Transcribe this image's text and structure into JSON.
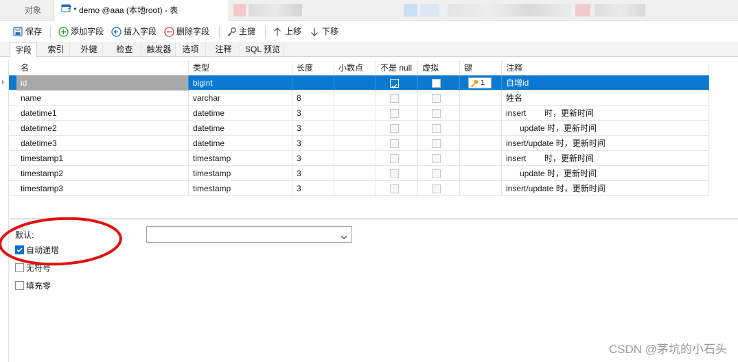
{
  "window_tabs": [
    {
      "label": "对象"
    },
    {
      "label": "* demo @aaa (本地root) - 表"
    }
  ],
  "toolbar": {
    "save": "保存",
    "add_field": "添加字段",
    "insert_field": "插入字段",
    "delete_field": "删除字段",
    "primary_key": "主键",
    "move_up": "上移",
    "move_down": "下移"
  },
  "sub_tabs": [
    "字段",
    "索引",
    "外键",
    "检查",
    "触发器",
    "选项",
    "注释",
    "SQL 预览"
  ],
  "grid": {
    "columns": [
      "名",
      "类型",
      "长度",
      "小数点",
      "不是 null",
      "虚拟",
      "键",
      "注释"
    ],
    "rows": [
      {
        "name": "id",
        "type": "bigint",
        "length": "",
        "decimals": "",
        "not_null": true,
        "virtual": false,
        "key": "1",
        "comment": "自增id"
      },
      {
        "name": "name",
        "type": "varchar",
        "length": "8",
        "decimals": "",
        "not_null": false,
        "virtual": false,
        "key": "",
        "comment": "姓名"
      },
      {
        "name": "datetime1",
        "type": "datetime",
        "length": "3",
        "decimals": "",
        "not_null": false,
        "virtual": false,
        "key": "",
        "comment": "insert        时，更新时间"
      },
      {
        "name": "datetime2",
        "type": "datetime",
        "length": "3",
        "decimals": "",
        "not_null": false,
        "virtual": false,
        "key": "",
        "comment": "      update 时，更新时间"
      },
      {
        "name": "datetime3",
        "type": "datetime",
        "length": "3",
        "decimals": "",
        "not_null": false,
        "virtual": false,
        "key": "",
        "comment": "insert/update 时，更新时间"
      },
      {
        "name": "timestamp1",
        "type": "timestamp",
        "length": "3",
        "decimals": "",
        "not_null": false,
        "virtual": false,
        "key": "",
        "comment": "insert        时，更新时间"
      },
      {
        "name": "timestamp2",
        "type": "timestamp",
        "length": "3",
        "decimals": "",
        "not_null": false,
        "virtual": false,
        "key": "",
        "comment": "      update 时，更新时间"
      },
      {
        "name": "timestamp3",
        "type": "timestamp",
        "length": "3",
        "decimals": "",
        "not_null": false,
        "virtual": false,
        "key": "",
        "comment": "insert/update 时，更新时间"
      }
    ]
  },
  "properties": {
    "default_label": "默认:",
    "default_value": "",
    "auto_increment_label": "自动递增",
    "auto_increment": true,
    "unsigned_label": "无符号",
    "unsigned": false,
    "zerofill_label": "填充零",
    "zerofill": false
  },
  "watermark": "CSDN @茅坑的小石头",
  "colors": {
    "selection": "#0b79d0",
    "annotation_circle": "#e0120f"
  }
}
